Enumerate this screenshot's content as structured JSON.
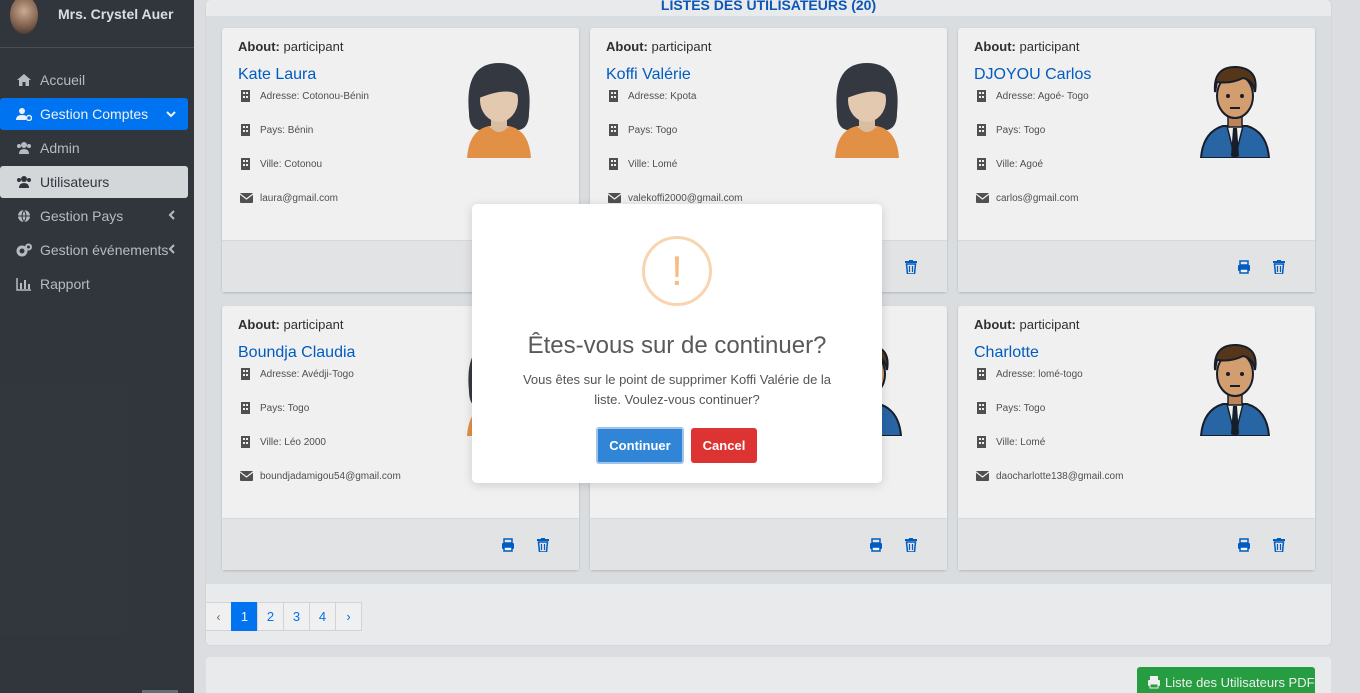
{
  "sidebar": {
    "user_name": "Mrs. Crystel Auer",
    "items": [
      {
        "label": "Accueil",
        "icon": "home-icon"
      },
      {
        "label": "Gestion Comptes",
        "icon": "user-cog-icon"
      },
      {
        "label": "Admin",
        "icon": "users-icon"
      },
      {
        "label": "Utilisateurs",
        "icon": "users-icon"
      },
      {
        "label": "Gestion Pays",
        "icon": "globe-icon"
      },
      {
        "label": "Gestion événements",
        "icon": "cogs-icon"
      },
      {
        "label": "Rapport",
        "icon": "chart-icon"
      }
    ]
  },
  "page": {
    "list_title": "LISTES DES UTILISATEURS (20)",
    "about_label": "About:",
    "users": [
      {
        "role": "participant",
        "name": "Kate Laura",
        "adresse": "Adresse: Cotonou-Bénin",
        "pays": "Pays: Bénin",
        "ville": "Ville: Cotonou",
        "email": "laura@gmail.com",
        "avatar": "female-avatar-icon"
      },
      {
        "role": "participant",
        "name": "Koffi Valérie",
        "adresse": "Adresse: Kpota",
        "pays": "Pays: Togo",
        "ville": "Ville: Lomé",
        "email": "valekoffi2000@gmail.com",
        "avatar": "female-avatar-icon"
      },
      {
        "role": "participant",
        "name": "DJOYOU Carlos",
        "adresse": "Adresse: Agoé- Togo",
        "pays": "Pays: Togo",
        "ville": "Ville: Agoé",
        "email": "carlos@gmail.com",
        "avatar": "male-avatar-icon"
      },
      {
        "role": "participant",
        "name": "Boundja Claudia",
        "adresse": "Adresse: Avédji-Togo",
        "pays": "Pays: Togo",
        "ville": "Ville: Léo 2000",
        "email": "boundjadamigou54@gmail.com",
        "avatar": "female-avatar-icon"
      },
      {
        "role": "",
        "name": "",
        "adresse": "",
        "pays": "",
        "ville": "",
        "email": "",
        "avatar": "male-avatar-icon"
      },
      {
        "role": "participant",
        "name": "Charlotte",
        "adresse": "Adresse: lomé-togo",
        "pays": "Pays: Togo",
        "ville": "Ville: Lomé",
        "email": "daocharlotte138@gmail.com",
        "avatar": "male-avatar-icon"
      }
    ],
    "pagination": [
      "‹",
      "1",
      "2",
      "3",
      "4",
      "›"
    ],
    "pdf_button": "Liste des Utilisateurs PDF"
  },
  "modal": {
    "icon": "!",
    "title": "Êtes-vous sur de continuer?",
    "text": "Vous êtes sur le point de supprimer Koffi Valérie de la liste. Voulez-vous continuer?",
    "confirm": "Continuer",
    "cancel": "Cancel"
  },
  "colors": {
    "sidebar_bg": "#343a40",
    "primary": "#007bff",
    "success": "#28a745",
    "confirm": "#3085d6",
    "cancel": "#dd3333",
    "warning_icon": "#f8bb86"
  }
}
